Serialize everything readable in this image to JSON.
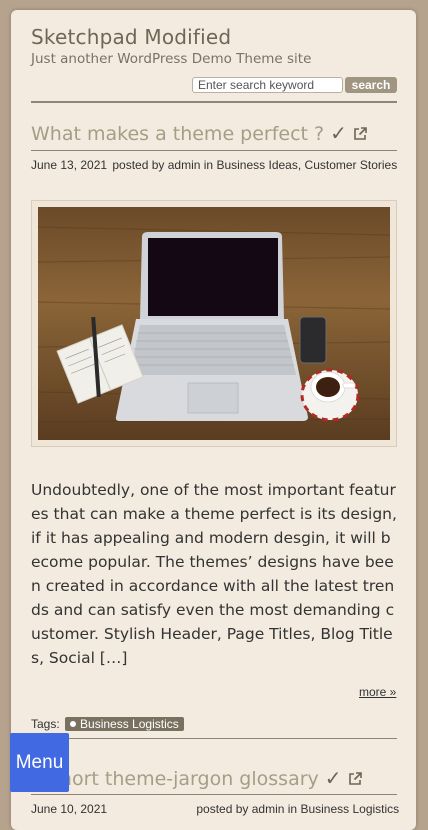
{
  "site": {
    "title": "Sketchpad Modified",
    "description": "Just another WordPress Demo Theme site"
  },
  "search": {
    "placeholder": "Enter search keyword",
    "button_label": "search"
  },
  "post": {
    "title": "What makes a theme perfect ?",
    "date": "June 13, 2021",
    "posted_by_text": "posted by",
    "author": "admin",
    "in_text": "in",
    "categories": [
      "Business Ideas",
      "Customer Stories"
    ],
    "category_separator": ",",
    "image_alt": "laptop on a wooden desk",
    "excerpt": "Undoubtedly, one of the most important features that can make a theme perfect is its design, if it has appealing and modern desgin, it will become popular. The themes’ designs have been created in accordance with all the latest trends and can satisfy even the most demanding customer. Stylish Header, Page Titles, Blog Titles, Social […]",
    "more_label": "more »",
    "tags_label": "Tags:",
    "tags": [
      "Business Logistics"
    ]
  },
  "post2": {
    "title": "A short theme-jargon glossary",
    "date": "June 10, 2021",
    "posted_by_text": "posted by",
    "author": "admin",
    "in_text": "in",
    "category": "Business Logistics"
  },
  "menu_button_label": "Menu",
  "icons": [
    "checkmark-icon",
    "external-link-icon",
    "tag-dot-icon"
  ]
}
